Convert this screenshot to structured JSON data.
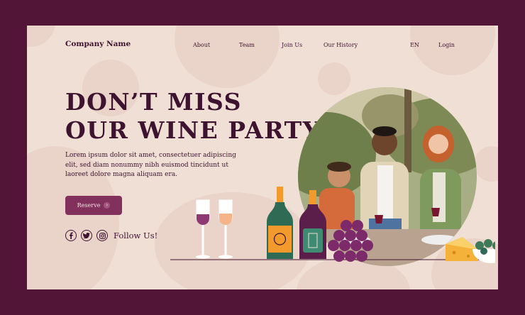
{
  "header": {
    "brand": "Company Name",
    "nav": [
      "About",
      "Team",
      "Join Us",
      "Our History"
    ],
    "lang": "EN",
    "login": "Login"
  },
  "hero": {
    "headline_line1": "DON’T MISS",
    "headline_line2": "OUR WINE PARTY",
    "body": "Lorem ipsum dolor sit amet, consectetuer adipiscing elit, sed diam nonummy nibh euismod tincidunt ut laoreet dolore magna aliquam era.",
    "cta_label": "Reserve",
    "cta_icon": "chevron-right-icon"
  },
  "social": {
    "icons": [
      "facebook-icon",
      "twitter-icon",
      "instagram-icon"
    ],
    "follow_label": "Follow Us!"
  },
  "colors": {
    "frame": "#521537",
    "background": "#f0dfd5",
    "text": "#3d1330",
    "button": "#82305c"
  }
}
